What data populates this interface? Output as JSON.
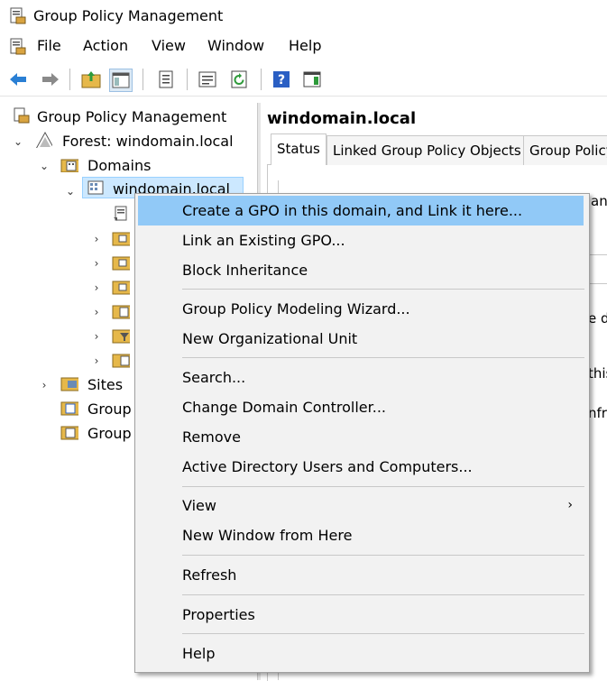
{
  "window": {
    "title": "Group Policy Management"
  },
  "menubar": {
    "items": [
      "File",
      "Action",
      "View",
      "Window",
      "Help"
    ]
  },
  "toolbar": {
    "buttons": [
      "back-icon",
      "forward-icon",
      "up-folder-icon",
      "show-hide-tree-icon",
      "copy-icon",
      "properties-icon",
      "refresh-icon",
      "help-icon",
      "action-pane-icon"
    ]
  },
  "tree": {
    "root": "Group Policy Management",
    "forest": "Forest: windomain.local",
    "domains": "Domains",
    "domain": "windomain.local",
    "sites": "Sites",
    "item_modeling": "Group",
    "item_results": "Group"
  },
  "pane": {
    "title": "windomain.local",
    "tabs": [
      "Status",
      "Linked Group Policy Objects",
      "Group Policy"
    ],
    "fragments": [
      "an",
      "e d",
      "this",
      "nfr"
    ]
  },
  "context_menu": {
    "groups": [
      [
        "Create a GPO in this domain, and Link it here...",
        "Link an Existing GPO...",
        "Block Inheritance"
      ],
      [
        "Group Policy Modeling Wizard...",
        "New Organizational Unit"
      ],
      [
        "Search...",
        "Change Domain Controller...",
        "Remove",
        "Active Directory Users and Computers..."
      ],
      [
        "View",
        "New Window from Here"
      ],
      [
        "Refresh"
      ],
      [
        "Properties"
      ],
      [
        "Help"
      ]
    ],
    "highlighted": "Create a GPO in this domain, and Link it here...",
    "submenu_item": "View"
  }
}
